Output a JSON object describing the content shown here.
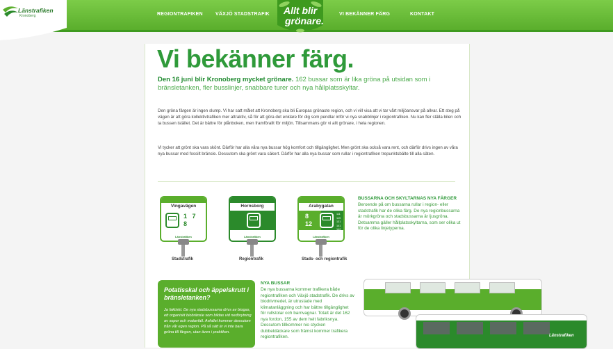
{
  "header": {
    "logo_name": "Länstrafiken",
    "logo_sub": "Kronoberg",
    "nav": [
      "REGIONTRAFIKEN",
      "VÄXJÖ STADSTRAFIK",
      "VI BEKÄNNER FÄRG",
      "KONTAKT"
    ],
    "slogan_line1": "Allt blir",
    "slogan_line2": "grönare."
  },
  "main": {
    "title": "Vi bekänner färg.",
    "lead_bold": "Den 16 juni blir Kronoberg mycket grönare.",
    "lead_rest": " 162 bussar som är lika gröna på utsidan som i bränsletanken, fler busslinjer, snabbare turer och nya hållplatsskyltar.",
    "para1": "Den gröna färgen är ingen slump. Vi har satt målet att Kronoberg ska bli Europas grönaste region, och vi vill visa att vi tar vårt miljöansvar på allvar. Ett steg på vägen är att göra kollektivtrafiken mer attraktiv, så för att göra det enklare för dig som pendlar inför vi nya snabblinjer i regiontrafiken. Nu kan fler ställa bilen och ta bussen istället. Det är bättre för plånboken, men framförallt för miljön. Tillsammans gör vi allt grönare, i hela regionen.",
    "para2": "Vi tycker att grönt ska vara skönt. Därför har alla våra nya bussar hög komfort och tillgänglighet. Men grönt ska också vara rent, och därför drivs ingen av våra nya bussar med fossilt bränsle. Dessutom ska grönt vara säkert. Därför har alla nya bussar som rullar i regiontrafiken trepunktsbälte till alla säten."
  },
  "signs": [
    {
      "name": "Vingavägen",
      "nums": [
        "1",
        "7",
        "8"
      ],
      "label": "Stadstrafik"
    },
    {
      "name": "Hornsborg",
      "nums": [],
      "label": "Regiontrafik"
    },
    {
      "name": "Arabygatan",
      "nums": [
        "8",
        "12"
      ],
      "small": [
        "111",
        "119",
        "131",
        "141",
        "142",
        "144",
        "145"
      ],
      "label": "Stads- och regiontrafik"
    }
  ],
  "sign_logo": "Länstrafiken",
  "bus_signs": {
    "heading": "BUSSARNA OCH SKYLTARNAS NYA FÄRGER",
    "text": "Beroende på om bussarna rullar i region- eller stadstrafik har de olika färg. De nya regionbussarna är mörkgröna och stadsbussarna är ljusgröna. Detsamma gäller hållplatsskyltarna, som ser olika ut för de olika linjetyperna."
  },
  "greenbox": {
    "title": "Potatisskal och äppelskrutt i bränsletanken?",
    "text": "Ja faktiskt. De nya stadsbussarna drivs av biogas, ett organiskt biobränsle som bildas vid nedbrytning av sopor och matavfall. Avfallet kommer dessutom från vår egen region. På så sätt är vi inte bara gröna till färgen, utan även i praktiken."
  },
  "nya_bussar": {
    "heading": "NYA BUSSAR",
    "text": "De nya bussarna kommer trafikera både regiontrafiken och Växjö stadstrafik. De drivs av biodrivmedel, är utrustade med klimatanläggning och har bättre tillgänglighet för rullstolar och barnvagnar. Totalt är det 162 nya fordon, 155 av dem helt fabriksnya. Dessutom tillkommer nio stycken dubbeldäckare som främst kommer trafikera regiontrafiken."
  },
  "bus_logo": "Länstrafiken",
  "colors": {
    "accent": "#5aae2c",
    "dark_green": "#2b8a2b",
    "title_green": "#2f9a3a"
  }
}
